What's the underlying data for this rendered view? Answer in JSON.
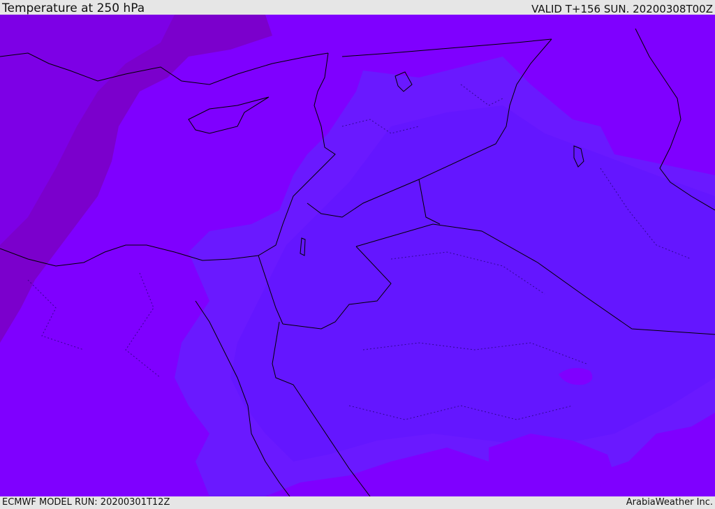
{
  "header": {
    "title": "Temperature at 250 hPa",
    "valid": "VALID T+156 SUN. 20200308T00Z"
  },
  "footer": {
    "model_run": "ECMWF MODEL RUN: 20200301T12Z",
    "credit": "ArabiaWeather Inc."
  },
  "map": {
    "colors": {
      "warmest": "#7b00cc",
      "warm": "#7f00ff",
      "mid": "#8a10ff",
      "cool": "#6a19ff",
      "cooler": "#6014ff",
      "coast": "#000000"
    }
  }
}
